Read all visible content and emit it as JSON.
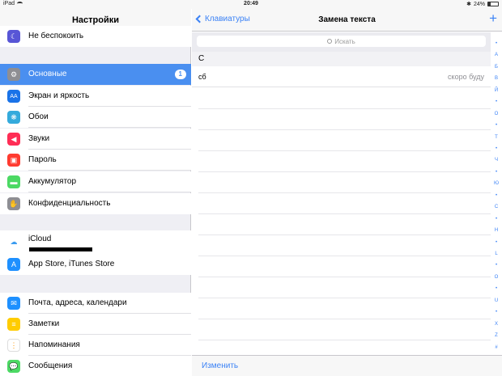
{
  "status_bar": {
    "device": "iPad",
    "time": "20:49",
    "battery": "24%"
  },
  "left": {
    "title": "Настройки",
    "items": [
      {
        "label": "Не беспокоить",
        "icon": "moon-icon",
        "color": "#5856d6"
      },
      {
        "label": "Основные",
        "icon": "gear-icon",
        "color": "#8e8e93",
        "badge": "1"
      },
      {
        "label": "Экран и яркость",
        "icon": "brightness-icon",
        "color": "#1a73e8"
      },
      {
        "label": "Обои",
        "icon": "wallpaper-icon",
        "color": "#34aadc"
      },
      {
        "label": "Звуки",
        "icon": "speaker-icon",
        "color": "#ff2d55"
      },
      {
        "label": "Пароль",
        "icon": "lock-icon",
        "color": "#ff3b30"
      },
      {
        "label": "Аккумулятор",
        "icon": "battery-icon",
        "color": "#4cd964"
      },
      {
        "label": "Конфиденциальность",
        "icon": "hand-icon",
        "color": "#8e8e93"
      },
      {
        "label": "iCloud",
        "icon": "cloud-icon",
        "color": "#ffffff"
      },
      {
        "label": "App Store, iTunes Store",
        "icon": "appstore-icon",
        "color": "#1e90ff"
      },
      {
        "label": "Почта, адреса, календари",
        "icon": "mail-icon",
        "color": "#1e90ff"
      },
      {
        "label": "Заметки",
        "icon": "notes-icon",
        "color": "#ffcc00"
      },
      {
        "label": "Напоминания",
        "icon": "reminders-icon",
        "color": "#ffffff"
      },
      {
        "label": "Сообщения",
        "icon": "messages-icon",
        "color": "#4cd964"
      }
    ]
  },
  "right": {
    "back_label": "Клавиатуры",
    "title": "Замена текста",
    "add": "+",
    "search_placeholder": "Искать",
    "section": "С",
    "entry": {
      "shortcut": "сб",
      "phrase": "скоро буду"
    },
    "edit_label": "Изменить",
    "index_letters": [
      "•",
      "А",
      "Б",
      "В",
      "Й",
      "•",
      "О",
      "•",
      "Т",
      "•",
      "Ч",
      "•",
      "Ю",
      "•",
      "С",
      "•",
      "Н",
      "•",
      "L",
      "•",
      "О",
      "•",
      "U",
      "•",
      "X",
      "Z",
      "#"
    ]
  },
  "colors": {
    "accent": "#3b82f6",
    "selected": "#4a8ff0"
  }
}
